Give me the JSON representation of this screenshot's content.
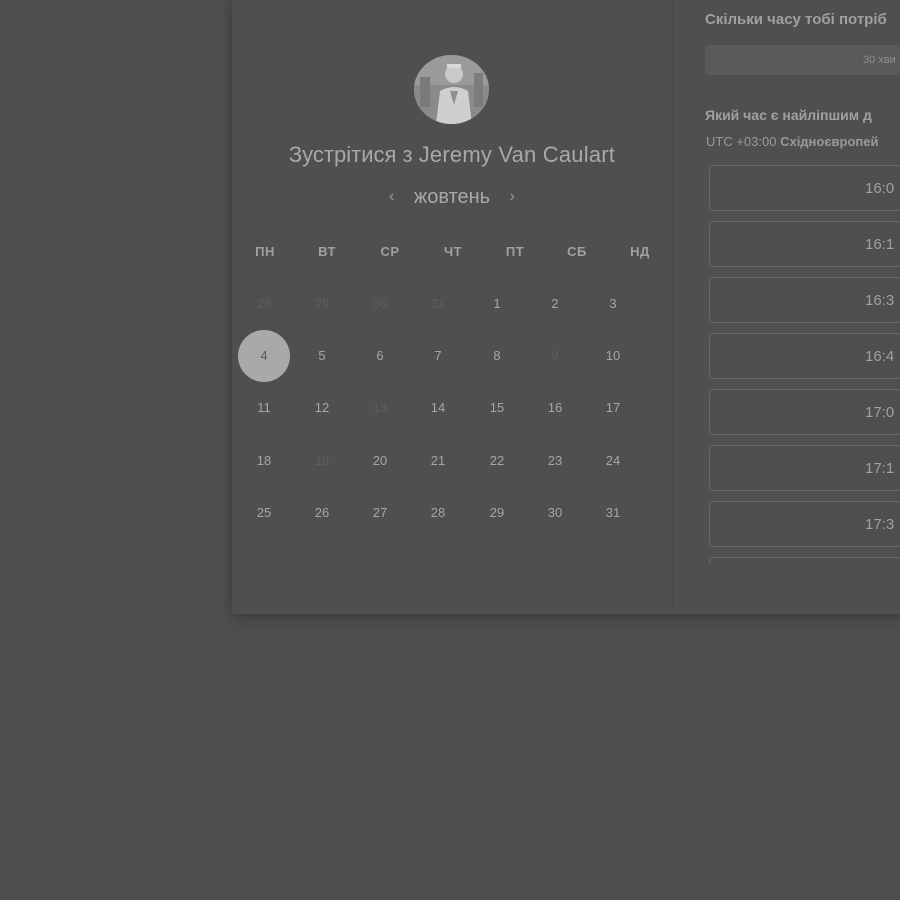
{
  "meeting": {
    "title_prefix": "Зустрітися з",
    "host_name": "Jeremy Van Caulart"
  },
  "calendar": {
    "month": "жовтень",
    "prev_icon": "‹",
    "next_icon": "›",
    "weekdays": [
      "ПН",
      "ВТ",
      "СР",
      "ЧТ",
      "ПТ",
      "СБ",
      "НД"
    ],
    "weeks": [
      [
        {
          "d": "28",
          "state": "muted"
        },
        {
          "d": "29",
          "state": "muted"
        },
        {
          "d": "30",
          "state": "muted"
        },
        {
          "d": "31",
          "state": "muted"
        },
        {
          "d": "1",
          "state": "available"
        },
        {
          "d": "2",
          "state": "available"
        },
        {
          "d": "3",
          "state": "available"
        }
      ],
      [
        {
          "d": "4",
          "state": "selected"
        },
        {
          "d": "5",
          "state": "available"
        },
        {
          "d": "6",
          "state": "available"
        },
        {
          "d": "7",
          "state": "available"
        },
        {
          "d": "8",
          "state": "available"
        },
        {
          "d": "9",
          "state": "muted"
        },
        {
          "d": "10",
          "state": "available"
        }
      ],
      [
        {
          "d": "11",
          "state": "available"
        },
        {
          "d": "12",
          "state": "available"
        },
        {
          "d": "13",
          "state": "muted"
        },
        {
          "d": "14",
          "state": "available"
        },
        {
          "d": "15",
          "state": "available"
        },
        {
          "d": "16",
          "state": "available"
        },
        {
          "d": "17",
          "state": "available"
        }
      ],
      [
        {
          "d": "18",
          "state": "available"
        },
        {
          "d": "19",
          "state": "muted"
        },
        {
          "d": "20",
          "state": "available"
        },
        {
          "d": "21",
          "state": "available"
        },
        {
          "d": "22",
          "state": "available"
        },
        {
          "d": "23",
          "state": "available"
        },
        {
          "d": "24",
          "state": "available"
        }
      ],
      [
        {
          "d": "25",
          "state": "available"
        },
        {
          "d": "26",
          "state": "available"
        },
        {
          "d": "27",
          "state": "available"
        },
        {
          "d": "28",
          "state": "available"
        },
        {
          "d": "29",
          "state": "available"
        },
        {
          "d": "30",
          "state": "available"
        },
        {
          "d": "31",
          "state": "available"
        }
      ]
    ]
  },
  "booking": {
    "duration_question": "Скільки часу тобі потріб",
    "duration_value": "30 хви",
    "time_question": "Який час є найліпшим д",
    "tz_offset": "UTC +03:00",
    "tz_name": "Східноєвропей",
    "slots": [
      "16:0",
      "16:1",
      "16:3",
      "16:4",
      "17:0",
      "17:1",
      "17:3"
    ]
  },
  "colors": {
    "selected_day": "#a9a9a9",
    "background": "#4e4e4e"
  }
}
